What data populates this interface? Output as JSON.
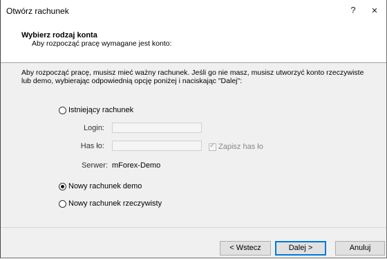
{
  "window": {
    "title": "Otwórz rachunek",
    "help": "?",
    "close": "×"
  },
  "header": {
    "title": "Wybierz rodzaj konta",
    "subtitle": "Aby rozpocząć pracę wymagane jest konto:"
  },
  "intro": "Aby rozpocząć pracę, musisz mieć ważny rachunek. Jeśli go nie masz, musisz utworzyć konto rzeczywiste lub demo, wybierając odpowiednią opcję poniżej i naciskając \"Dalej\":",
  "options": {
    "existing": {
      "label": "Istniejący rachunek",
      "selected": false
    },
    "demo": {
      "label": "Nowy rachunek demo",
      "selected": true
    },
    "real": {
      "label": "Nowy rachunek rzeczywisty",
      "selected": false
    }
  },
  "fields": {
    "login_label": "Login:",
    "login_value": "",
    "password_label": "Has ło:",
    "password_value": "",
    "save_password_label": "Zapisz has ło",
    "save_password_checked": true,
    "server_label": "Serwer:",
    "server_value": "mForex-Demo"
  },
  "buttons": {
    "back": "< Wstecz",
    "next": "Dalej >",
    "cancel": "Anuluj"
  }
}
